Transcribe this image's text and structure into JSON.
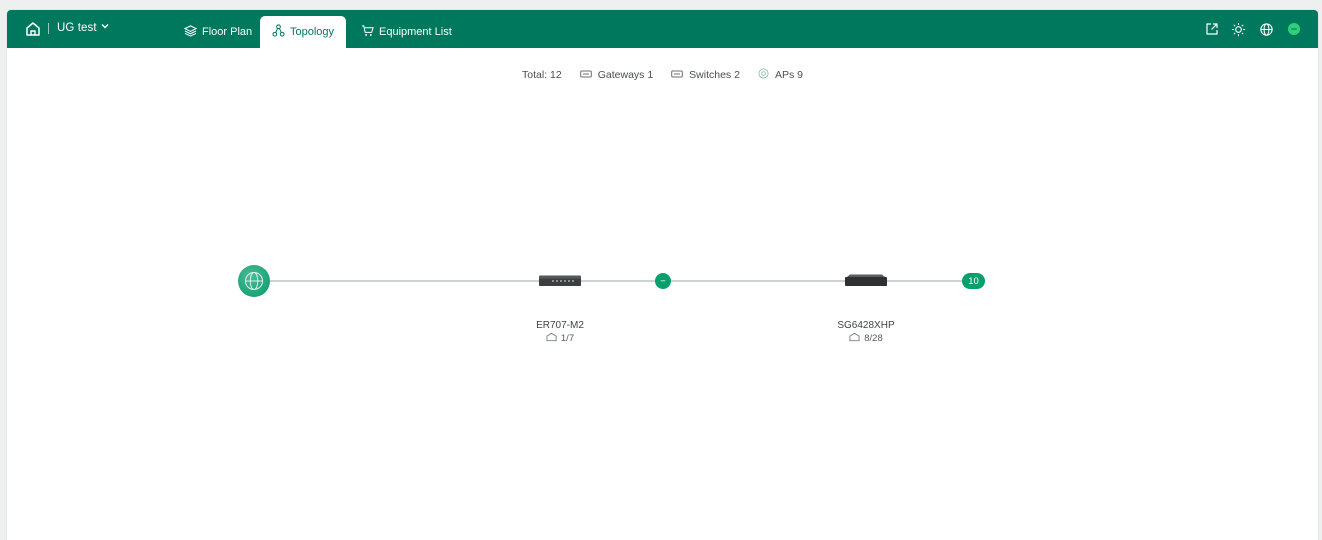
{
  "header": {
    "site_name": "UG test",
    "tabs": [
      {
        "label": "Floor Plan",
        "icon": "layers-icon"
      },
      {
        "label": "Topology",
        "icon": "topology-icon",
        "active": true
      },
      {
        "label": "Equipment List",
        "icon": "cart-icon"
      }
    ],
    "right_icons": [
      "export-icon",
      "theme-icon",
      "globe-icon",
      "status-dot-icon"
    ]
  },
  "stats": {
    "total": "Total: 12",
    "gateways": "Gateways 1",
    "switches": "Switches 2",
    "aps": "APs 9"
  },
  "topology": {
    "nodes": [
      {
        "type": "internet",
        "icon": "internet-globe-icon"
      },
      {
        "type": "gateway",
        "name": "ER707-M2",
        "ports": "1/7"
      },
      {
        "type": "switch",
        "name": "SG6428XHP",
        "ports": "8/28"
      }
    ],
    "collapse_badge": "−",
    "ap_count_badge": "10"
  },
  "colors": {
    "brand": "#00785e",
    "accent": "#06a06c",
    "line": "#9ea3a3"
  }
}
